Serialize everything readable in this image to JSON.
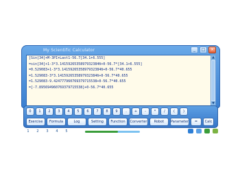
{
  "window": {
    "title": "My Scientific Calculator",
    "controls": [
      "_",
      "□",
      "×"
    ]
  },
  "display": {
    "lines": [
      "[Sin[34]+M-3PI+Last1-56.7[34.1+6.555]",
      "=sin[34]+1-3*3.1415926535897932384б+0-56.7*[34.1+6.555]",
      "=0.529083+1-3*3.1415926535897932384б+0-56.7*40.655",
      "=1.529083-3*3.1415926535897932384б+0-56.7*40.655",
      "=1.529083-9.424777960769379715538+0-56.7*40.655",
      "=[-7.895694960769379715538]+0-56.7*40.655"
    ]
  },
  "keypad": {
    "row1": [
      "0",
      "1",
      "2",
      "3",
      "4",
      "5",
      "6",
      "7",
      "8",
      "9",
      ".",
      "+",
      "-",
      "*",
      "/",
      "(",
      ")"
    ],
    "row2": [
      "Exercise",
      "Formula",
      "Log",
      "Setting",
      "Function",
      "Converter",
      "Robot",
      "Parameter",
      "=",
      "Calc"
    ]
  },
  "bottombar": {
    "pages": [
      "1",
      "2",
      "3",
      "4",
      "5"
    ],
    "slider_level": 0.6
  },
  "colors": {
    "frame": "#3a7fd0",
    "display_bg": "#fffbea",
    "text": "#0b2b8a"
  }
}
